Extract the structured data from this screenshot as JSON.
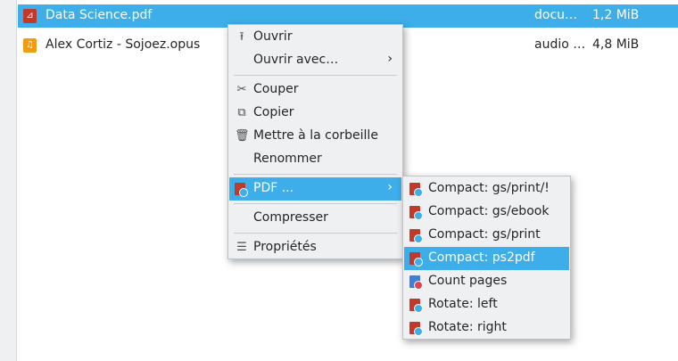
{
  "files": [
    {
      "name": "Data Science.pdf",
      "type": "docu…",
      "size": "1,2 MiB",
      "icon": "pdf-file-icon",
      "selected": true
    },
    {
      "name": "Alex Cortiz - Sojoez.opus",
      "type": "audio …",
      "size": "4,8 MiB",
      "icon": "audio-file-icon",
      "selected": false
    }
  ],
  "context_menu": {
    "open": "Ouvrir",
    "open_with": "Ouvrir avec…",
    "cut": "Couper",
    "copy": "Copier",
    "trash": "Mettre à la corbeille",
    "rename": "Renommer",
    "pdf": "PDF ...",
    "compress": "Compresser",
    "properties": "Propriétés"
  },
  "pdf_submenu": {
    "items": [
      "Compact: gs/print/!",
      "Compact: gs/ebook",
      "Compact: gs/print",
      "Compact: ps2pdf",
      "Count pages",
      "Rotate: left",
      "Rotate: right"
    ]
  },
  "colors": {
    "accent": "#3daee9",
    "menu_bg": "#eff0f1",
    "pdf_red": "#c0392b",
    "audio_orange": "#f39c12"
  }
}
